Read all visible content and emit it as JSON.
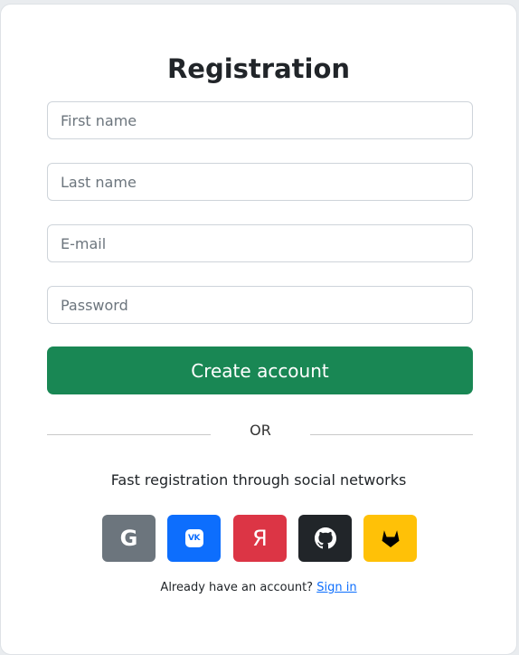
{
  "title": "Registration",
  "form": {
    "first_name_placeholder": "First name",
    "last_name_placeholder": "Last name",
    "email_placeholder": "E-mail",
    "password_placeholder": "Password",
    "submit_label": "Create account"
  },
  "divider_text": "OR",
  "social": {
    "heading": "Fast registration through social networks",
    "buttons": [
      {
        "name": "google",
        "glyph": "G",
        "color": "#6c757d",
        "icon": "google-icon"
      },
      {
        "name": "vk",
        "glyph": "VK",
        "color": "#0d6efd",
        "icon": "vk-icon"
      },
      {
        "name": "yandex",
        "glyph": "Я",
        "color": "#dc3545",
        "icon": "yandex-icon"
      },
      {
        "name": "github",
        "color": "#212529",
        "icon": "github-icon"
      },
      {
        "name": "gitlab",
        "color": "#ffc107",
        "icon": "gitlab-icon"
      }
    ]
  },
  "signin": {
    "prompt": "Already have an account?",
    "link": "Sign in"
  },
  "colors": {
    "primary_button": "#198754",
    "link": "#0d6efd"
  }
}
